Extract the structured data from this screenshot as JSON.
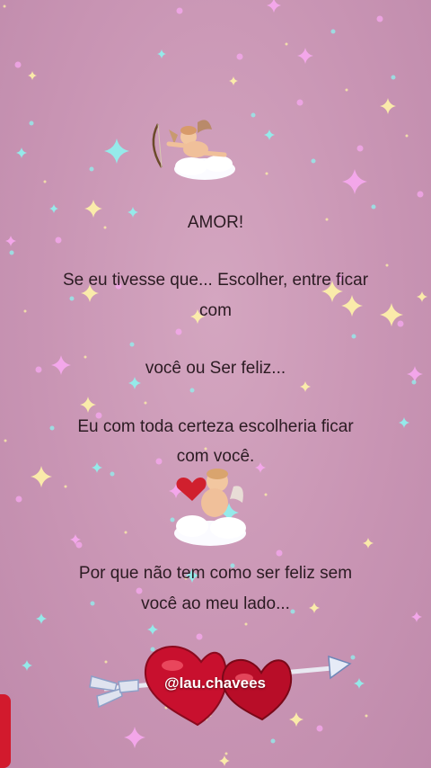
{
  "post": {
    "title": "AMOR!",
    "lines": [
      "Se eu tivesse que... Escolher, entre ficar",
      "com",
      "você ou Ser feliz...",
      "Eu com toda certeza  escolheria ficar",
      "com você.",
      "Por que não tem como ser feliz sem",
      "você ao meu lado..."
    ],
    "handle": "@lau.chavees"
  },
  "colors": {
    "background": "#c995b4",
    "text": "#2b1b22",
    "heart": "#c8102e",
    "sparkle_yellow": "#fff4a8",
    "sparkle_cyan": "#8ff3f0",
    "sparkle_pink": "#f7a8f0"
  },
  "icons": [
    "cupid-with-bow-icon",
    "cupid-with-heart-icon",
    "sparkle-icon",
    "double-heart-arrow-icon"
  ]
}
